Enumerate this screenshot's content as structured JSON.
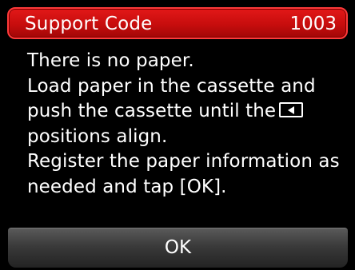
{
  "header": {
    "title": "Support Code",
    "code": "1003"
  },
  "message": {
    "lines": [
      "There is no paper.",
      "Load paper in the cassette and",
      "push the cassette until the",
      "positions align.",
      "Register the paper information as",
      "needed and tap [OK]."
    ],
    "inline_icon": "triangle-marker-icon"
  },
  "ok_button": {
    "label": "OK"
  },
  "colors": {
    "header_red": "#d21010",
    "header_border": "#ff3a3a",
    "background": "#000000",
    "button_gray": "#3a3a3a",
    "text": "#ffffff"
  }
}
